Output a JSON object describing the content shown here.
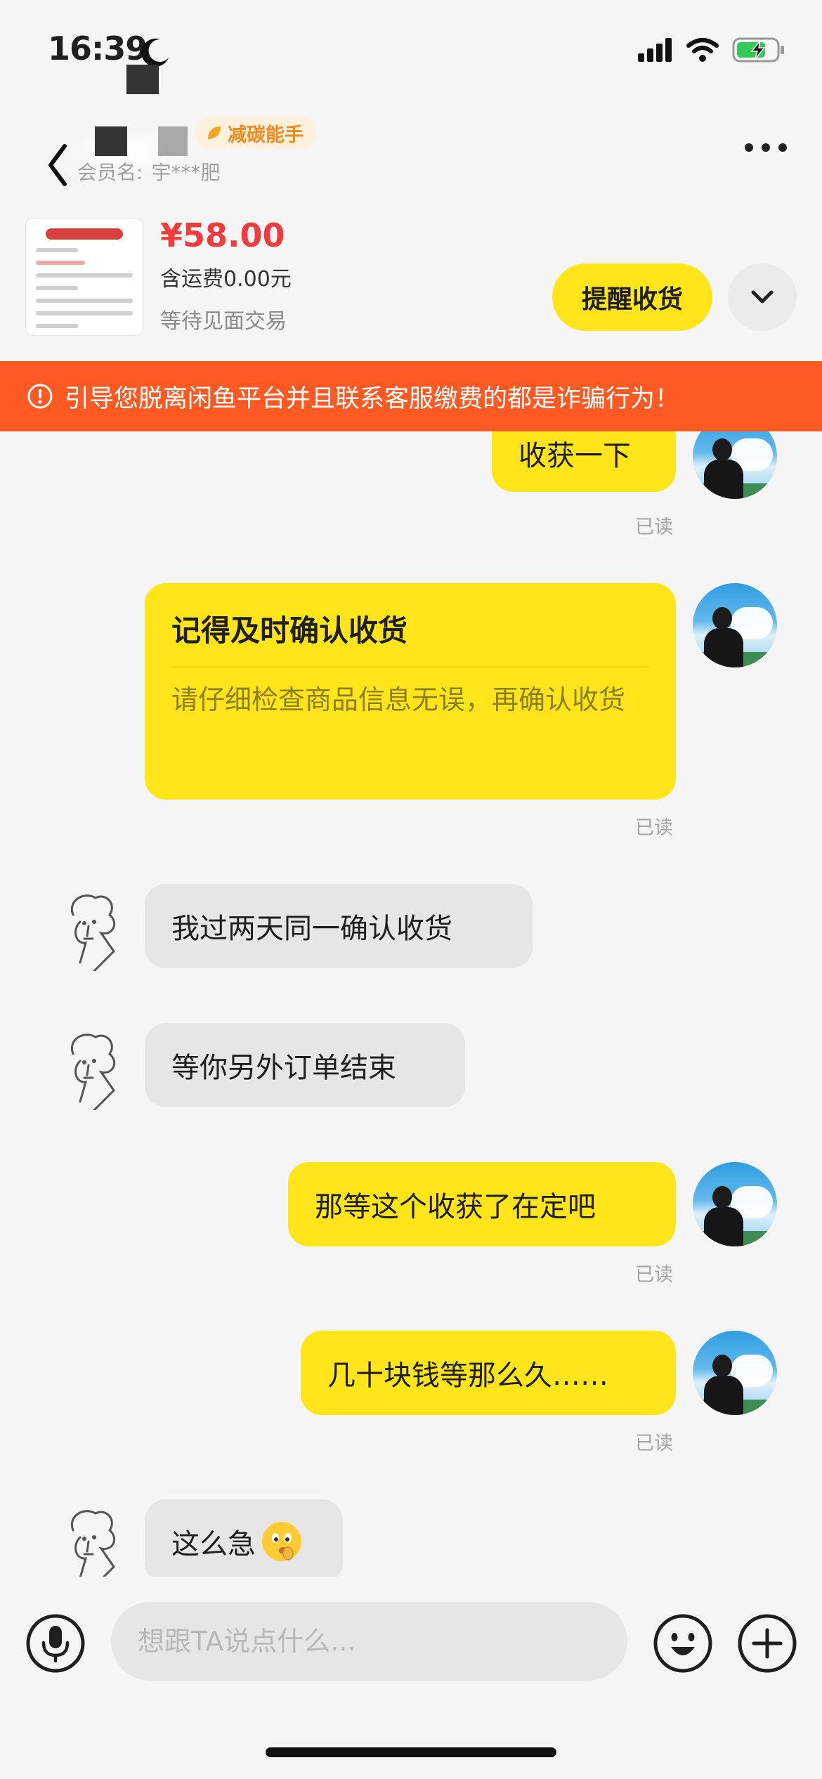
{
  "status_bar": {
    "time": "16:39"
  },
  "header": {
    "badge_label": "减碳能手",
    "member_label": "会员名:",
    "member_name": "宇***肥"
  },
  "product": {
    "price": "¥58.00",
    "shipping": "含运费0.00元",
    "status": "等待见面交易",
    "remind_label": "提醒收货"
  },
  "warning": {
    "text": "引导您脱离闲鱼平台并且联系客服缴费的都是诈骗行为！"
  },
  "messages": [
    {
      "side": "self",
      "text": "收获一下",
      "read": "已读"
    },
    {
      "side": "self",
      "type": "card",
      "title": "记得及时确认收货",
      "body": "请仔细检查商品信息无误，再确认收货",
      "read": "已读"
    },
    {
      "side": "other",
      "text": "我过两天同一确认收货"
    },
    {
      "side": "other",
      "text": "等你另外订单结束"
    },
    {
      "side": "self",
      "text": "那等这个收获了在定吧",
      "read": "已读"
    },
    {
      "side": "self",
      "text": "几十块钱等那么久……",
      "read": "已读"
    },
    {
      "side": "other",
      "text": "这么急",
      "emoji": "shushing-face"
    }
  ],
  "composer": {
    "placeholder": "想跟TA说点什么..."
  },
  "colors": {
    "accent_yellow": "#ffe51a",
    "warning_orange": "#ff5a24",
    "price_red": "#f03c3c",
    "background": "#f5f5f5"
  },
  "icons": [
    "moon-icon",
    "signal-icon",
    "wifi-icon",
    "battery-charging-icon",
    "back-icon",
    "more-icon",
    "chevron-down-icon",
    "warning-icon",
    "microphone-icon",
    "emoji-icon",
    "plus-icon"
  ]
}
